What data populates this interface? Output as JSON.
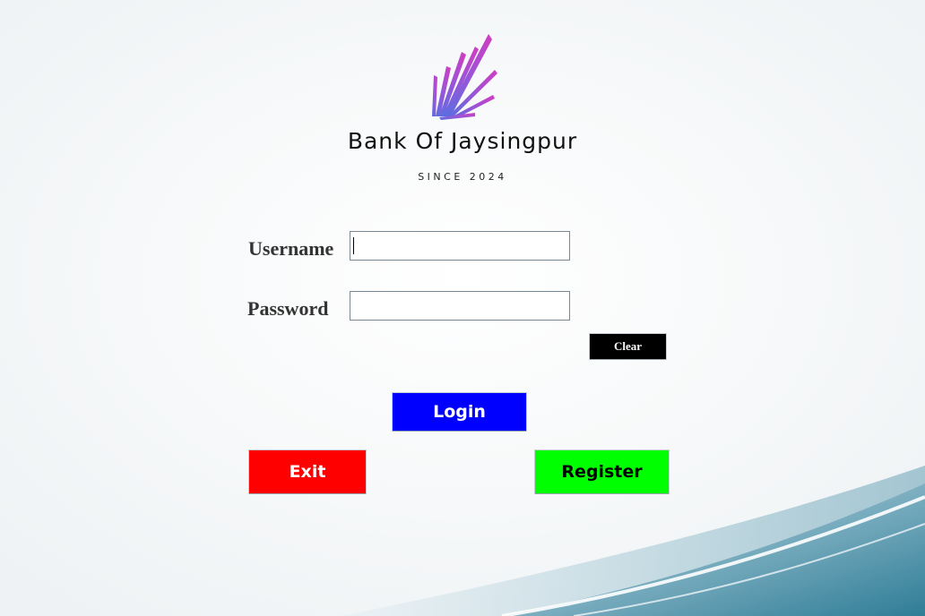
{
  "brand": {
    "name": "Bank Of Jaysingpur",
    "since": "SINCE 2024"
  },
  "form": {
    "username_label": "Username",
    "username_value": "",
    "password_label": "Password",
    "password_value": ""
  },
  "buttons": {
    "clear": "Clear",
    "login": "Login",
    "exit": "Exit",
    "register": "Register"
  },
  "colors": {
    "login": "#0000ff",
    "exit": "#ff0000",
    "register": "#00ff00",
    "clear": "#000000"
  }
}
